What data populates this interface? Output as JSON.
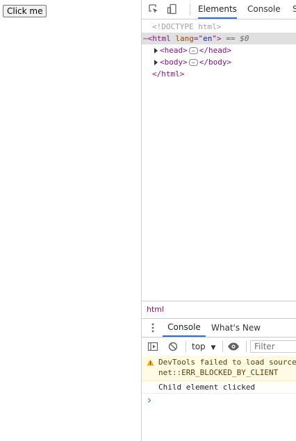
{
  "page": {
    "button_label": "Click me"
  },
  "devtools": {
    "tabs": [
      "Elements",
      "Console",
      "S"
    ],
    "dom": {
      "doctype": "<!DOCTYPE html>",
      "html_open": "<html",
      "lang_attr": " lang",
      "lang_eq": "=\"",
      "lang_val": "en",
      "html_close_bracket": "\">",
      "eq_marker": " == $0",
      "head_open": "<head>",
      "head_close": "</head>",
      "body_open": "<body>",
      "body_close": "</body>",
      "html_end": "</html>"
    },
    "breadcrumb": "html",
    "drawer_tabs": [
      "Console",
      "What's New"
    ],
    "console_toolbar": {
      "context": "top",
      "filter_placeholder": "Filter"
    },
    "messages": {
      "warning_line1": "DevTools failed to load source",
      "warning_line2": "net::ERR_BLOCKED_BY_CLIENT",
      "log": "Child element clicked"
    },
    "prompt": "›"
  }
}
